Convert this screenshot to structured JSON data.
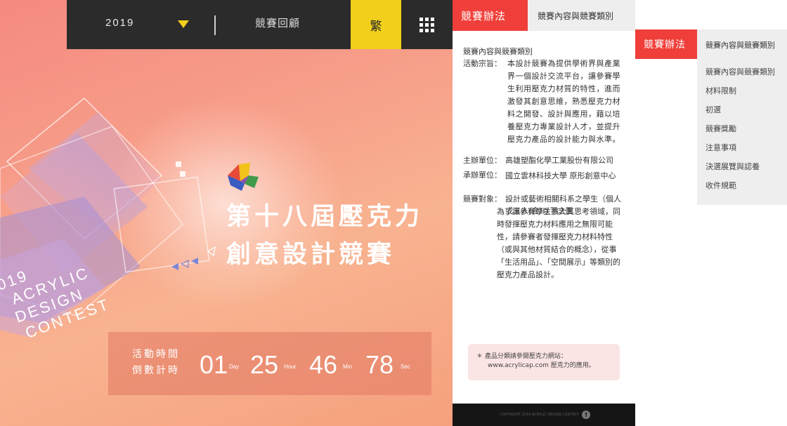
{
  "hero": {
    "year": "2019",
    "nav_review": "競賽回顧",
    "lang_toggle": "繁",
    "title_line1": "第十八屆壓克力",
    "title_line2": "創意設計競賽",
    "contest_words": [
      "2019",
      "ACRYLIC",
      "DESIGN",
      "CONTEST"
    ],
    "countdown": {
      "label1": "活動時間",
      "label2": "倒數計時",
      "days": "01",
      "days_unit": "Day",
      "hours": "25",
      "hours_unit": "Hour",
      "minutes": "46",
      "minutes_unit": "Min",
      "seconds": "78",
      "seconds_unit": "Sec"
    },
    "colors": {
      "topbar": "#2b2b2b",
      "accent_yellow": "#f2cf1a"
    }
  },
  "mobile": {
    "tab_active": "競賽辦法",
    "tab_other": "競賽內容與競賽類別",
    "section_title": "競賽內容與競賽類別",
    "purpose_label": "活動宗旨：",
    "purpose_text": "本設計競賽為提供學術界與產業界一個設計交流平台，讓參賽學生利用壓克力材質的特性，進而激發其創意思維，熟悉壓克力材料之開發、設計與應用，藉以培養壓克力專業設計人才，並提升壓克力產品的設計能力與水準。",
    "organizer_label": "主辦單位：",
    "organizer_text": "高雄塑酯化學工業股份有限公司",
    "coorganizer_label": "承辦單位：",
    "coorganizer_text": "國立雲林科技大學 原形創意中心",
    "target_label": "競賽對象：",
    "target_text": "設計或藝術相關科系之學生（個人或三人(含)以下之團",
    "overlap_text": "為了讓參賽學生擴大其思考領域，同時發揮壓克力材料應用之無限可能性，請參賽者發揮壓克力材料特性（或與其他材質結合的概念），從事「生活用品」、「空間展示」等類別的壓克力產品設計。",
    "note_line1": "＊ 產品分類請參閱壓克力網站：",
    "note_line2": "www.acrylicap.com 壓克力的應用。",
    "footer_copyright": "COPYRIGHT 2019 ACRYLIC DESIGN CONTEST",
    "footer_icon": "facebook-icon",
    "accent_red": "#f03f3a"
  },
  "menu": {
    "tab_active": "競賽辦法",
    "header": "競賽內容與競賽類別",
    "items": [
      "競賽內容與競賽類別",
      "材料限制",
      "初選",
      "競賽獎勵",
      "注意事項",
      "決選展覽與認養",
      "收件規範"
    ]
  }
}
